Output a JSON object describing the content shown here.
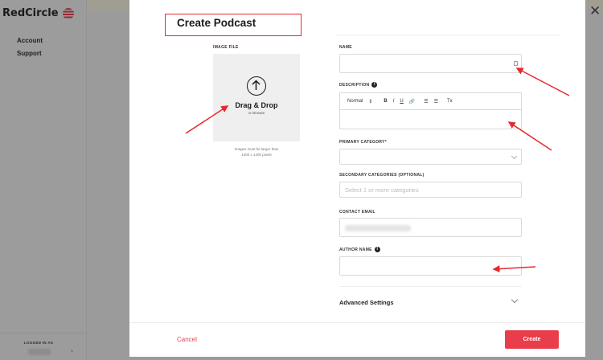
{
  "app": {
    "logo_text": "RedCircle",
    "nav": [
      "Account",
      "Support"
    ],
    "footer_label": "LOGGED IN AS"
  },
  "modal": {
    "title": "Create Podcast",
    "image": {
      "label": "IMAGE FILE",
      "drop_title": "Drag & Drop",
      "drop_sub": "or Browse",
      "hint_line1": "Images must be larger than",
      "hint_line2": "1400 x 1400 pixels"
    },
    "fields": {
      "name_label": "NAME",
      "description_label": "DESCRIPTION",
      "editor_toolbar": [
        "Normal",
        "⇕",
        "B",
        "I",
        "U",
        "🔗",
        "☰",
        "☰",
        "Tx"
      ],
      "primary_category_label": "PRIMARY CATEGORY*",
      "secondary_categories_label": "SECONDARY CATEGORIES (OPTIONAL)",
      "secondary_placeholder": "Select 1 or more categories",
      "contact_email_label": "CONTACT EMAIL",
      "author_name_label": "AUTHOR NAME"
    },
    "advanced_settings": "Advanced Settings",
    "cancel": "Cancel",
    "create": "Create"
  },
  "colors": {
    "accent": "#ea3d4b",
    "annotation": "#e8282f"
  },
  "icons": {
    "close": "close-icon",
    "upload": "upload-arrow-icon",
    "info": "info-icon",
    "chevron": "chevron-down-icon"
  }
}
